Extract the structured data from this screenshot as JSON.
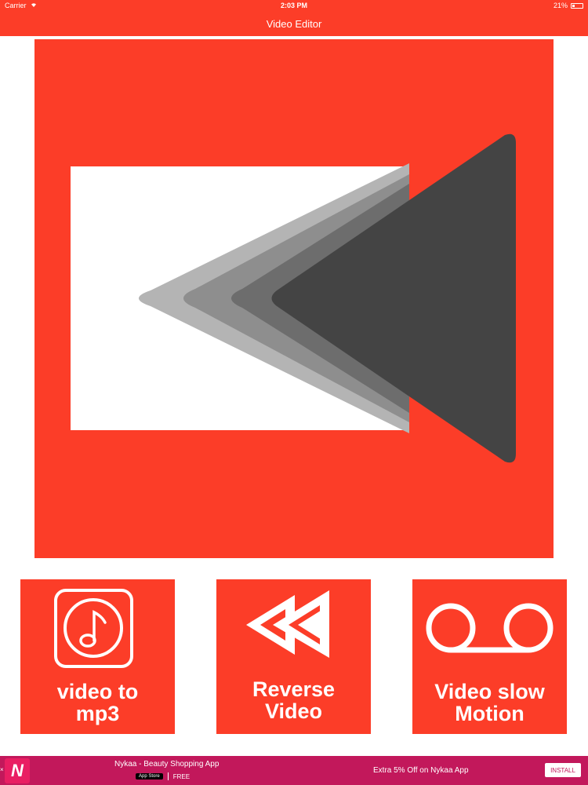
{
  "status_bar": {
    "carrier": "Carrier",
    "time": "2:03 PM",
    "battery": "21%"
  },
  "nav": {
    "title": "Video Editor"
  },
  "tiles": [
    {
      "line1": "video to",
      "line2": "mp3",
      "icon": "music-note-icon"
    },
    {
      "line1": "Reverse",
      "line2": "Video",
      "icon": "rewind-icon"
    },
    {
      "line1": "Video slow",
      "line2": "Motion",
      "icon": "tape-reel-icon"
    }
  ],
  "ad": {
    "app_name": "Nykaa - Beauty Shopping App",
    "store_label": "App Store",
    "price": "FREE",
    "promo": "Extra 5% Off on Nykaa App",
    "install_label": "INSTALL",
    "icon_letter": "N"
  },
  "colors": {
    "primary": "#fc3d28",
    "white": "#ffffff",
    "dark_gray": "#444444",
    "ad_bg": "#c2185b"
  }
}
